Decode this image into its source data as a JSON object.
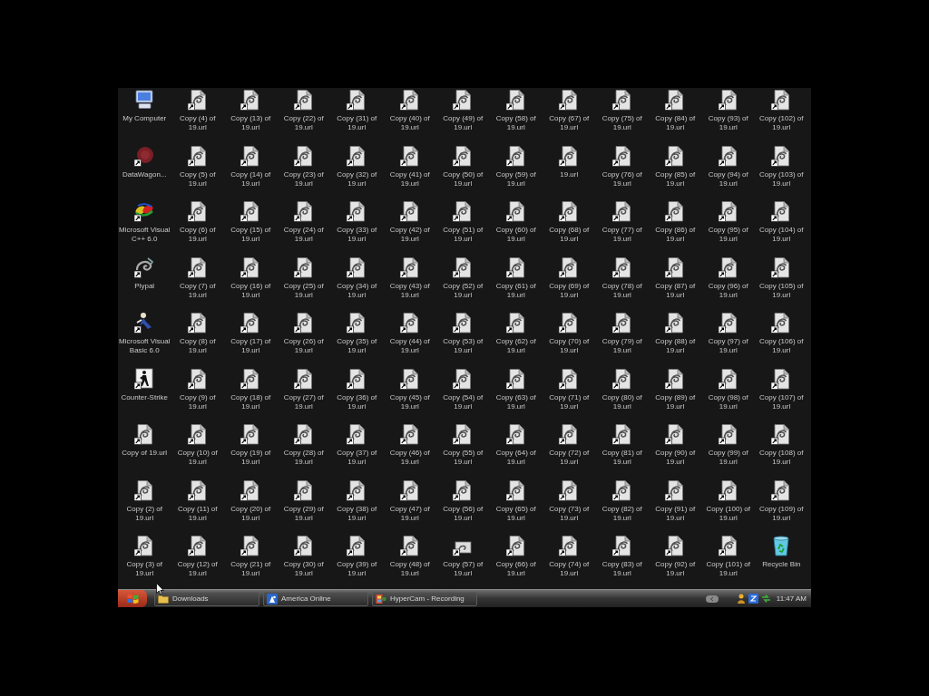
{
  "desktop": {
    "icons": [
      {
        "label": "My Computer",
        "kind": "computer",
        "shortcut": false
      },
      {
        "label": "DataWagon...",
        "kind": "disc",
        "shortcut": true
      },
      {
        "label": "Microsoft Visual C++ 6.0",
        "kind": "swirl",
        "shortcut": true
      },
      {
        "label": "Plypal",
        "kind": "knot",
        "shortcut": true
      },
      {
        "label": "Microsoft Visual Basic 6.0",
        "kind": "figure",
        "shortcut": true
      },
      {
        "label": "Counter-Strike",
        "kind": "soldier",
        "shortcut": true
      },
      {
        "label": "Copy of 19.url",
        "kind": "document",
        "shortcut": true
      },
      {
        "label": "Copy (2) of 19.url",
        "kind": "document",
        "shortcut": true
      },
      {
        "label": "Copy (3) of 19.url",
        "kind": "document",
        "shortcut": true
      },
      {
        "label": "Copy (4) of 19.url",
        "kind": "document",
        "shortcut": true
      },
      {
        "label": "Copy (5) of 19.url",
        "kind": "document",
        "shortcut": true
      },
      {
        "label": "Copy (6) of 19.url",
        "kind": "document",
        "shortcut": true
      },
      {
        "label": "Copy (7) of 19.url",
        "kind": "document",
        "shortcut": true
      },
      {
        "label": "Copy (8) of 19.url",
        "kind": "document",
        "shortcut": true
      },
      {
        "label": "Copy (9) of 19.url",
        "kind": "document",
        "shortcut": true
      },
      {
        "label": "Copy (10) of 19.url",
        "kind": "document",
        "shortcut": true
      },
      {
        "label": "Copy (11) of 19.url",
        "kind": "document",
        "shortcut": true
      },
      {
        "label": "Copy (12) of 19.url",
        "kind": "document",
        "shortcut": true
      },
      {
        "label": "Copy (13) of 19.url",
        "kind": "document",
        "shortcut": true
      },
      {
        "label": "Copy (14) of 19.url",
        "kind": "document",
        "shortcut": true
      },
      {
        "label": "Copy (15) of 19.url",
        "kind": "document",
        "shortcut": true
      },
      {
        "label": "Copy (16) of 19.url",
        "kind": "document",
        "shortcut": true
      },
      {
        "label": "Copy (17) of 19.url",
        "kind": "document",
        "shortcut": true
      },
      {
        "label": "Copy (18) of 19.url",
        "kind": "document",
        "shortcut": true
      },
      {
        "label": "Copy (19) of 19.url",
        "kind": "document",
        "shortcut": true
      },
      {
        "label": "Copy (20) of 19.url",
        "kind": "document",
        "shortcut": true
      },
      {
        "label": "Copy (21) of 19.url",
        "kind": "document",
        "shortcut": true
      },
      {
        "label": "Copy (22) of 19.url",
        "kind": "document",
        "shortcut": true
      },
      {
        "label": "Copy (23) of 19.url",
        "kind": "document",
        "shortcut": true
      },
      {
        "label": "Copy (24) of 19.url",
        "kind": "document",
        "shortcut": true
      },
      {
        "label": "Copy (25) of 19.url",
        "kind": "document",
        "shortcut": true
      },
      {
        "label": "Copy (26) of 19.url",
        "kind": "document",
        "shortcut": true
      },
      {
        "label": "Copy (27) of 19.url",
        "kind": "document",
        "shortcut": true
      },
      {
        "label": "Copy (28) of 19.url",
        "kind": "document",
        "shortcut": true
      },
      {
        "label": "Copy (29) of 19.url",
        "kind": "document",
        "shortcut": true
      },
      {
        "label": "Copy (30) of 19.url",
        "kind": "document",
        "shortcut": true
      },
      {
        "label": "Copy (31) of 19.url",
        "kind": "document",
        "shortcut": true
      },
      {
        "label": "Copy (32) of 19.url",
        "kind": "document",
        "shortcut": true
      },
      {
        "label": "Copy (33) of 19.url",
        "kind": "document",
        "shortcut": true
      },
      {
        "label": "Copy (34) of 19.url",
        "kind": "document",
        "shortcut": true
      },
      {
        "label": "Copy (35) of 19.url",
        "kind": "document",
        "shortcut": true
      },
      {
        "label": "Copy (36) of 19.url",
        "kind": "document",
        "shortcut": true
      },
      {
        "label": "Copy (37) of 19.url",
        "kind": "document",
        "shortcut": true
      },
      {
        "label": "Copy (38) of 19.url",
        "kind": "document",
        "shortcut": true
      },
      {
        "label": "Copy (39) of 19.url",
        "kind": "document",
        "shortcut": true
      },
      {
        "label": "Copy (40) of 19.url",
        "kind": "document",
        "shortcut": true
      },
      {
        "label": "Copy (41) of 19.url",
        "kind": "document",
        "shortcut": true
      },
      {
        "label": "Copy (42) of 19.url",
        "kind": "document",
        "shortcut": true
      },
      {
        "label": "Copy (43) of 19.url",
        "kind": "document",
        "shortcut": true
      },
      {
        "label": "Copy (44) of 19.url",
        "kind": "document",
        "shortcut": true
      },
      {
        "label": "Copy (45) of 19.url",
        "kind": "document",
        "shortcut": true
      },
      {
        "label": "Copy (46) of 19.url",
        "kind": "document",
        "shortcut": true
      },
      {
        "label": "Copy (47) of 19.url",
        "kind": "document",
        "shortcut": true
      },
      {
        "label": "Copy (48) of 19.url",
        "kind": "document",
        "shortcut": true
      },
      {
        "label": "Copy (49) of 19.url",
        "kind": "document",
        "shortcut": true
      },
      {
        "label": "Copy (50) of 19.url",
        "kind": "document",
        "shortcut": true
      },
      {
        "label": "Copy (51) of 19.url",
        "kind": "document",
        "shortcut": true
      },
      {
        "label": "Copy (52) of 19.url",
        "kind": "document",
        "shortcut": true
      },
      {
        "label": "Copy (53) of 19.url",
        "kind": "document",
        "shortcut": true
      },
      {
        "label": "Copy (54) of 19.url",
        "kind": "document",
        "shortcut": true
      },
      {
        "label": "Copy (55) of 19.url",
        "kind": "document",
        "shortcut": true
      },
      {
        "label": "Copy (56) of 19.url",
        "kind": "document",
        "shortcut": true
      },
      {
        "label": "Copy (57) of 19.url",
        "kind": "card",
        "shortcut": true
      },
      {
        "label": "Copy (58) of 19.url",
        "kind": "document",
        "shortcut": true
      },
      {
        "label": "Copy (59) of 19.url",
        "kind": "document",
        "shortcut": true
      },
      {
        "label": "Copy (60) of 19.url",
        "kind": "document",
        "shortcut": true
      },
      {
        "label": "Copy (61) of 19.url",
        "kind": "document",
        "shortcut": true
      },
      {
        "label": "Copy (62) of 19.url",
        "kind": "document",
        "shortcut": true
      },
      {
        "label": "Copy (63) of 19.url",
        "kind": "document",
        "shortcut": true
      },
      {
        "label": "Copy (64) of 19.url",
        "kind": "document",
        "shortcut": true
      },
      {
        "label": "Copy (65) of 19.url",
        "kind": "document",
        "shortcut": true
      },
      {
        "label": "Copy (66) of 19.url",
        "kind": "document",
        "shortcut": true
      },
      {
        "label": "Copy (67) of 19.url",
        "kind": "document",
        "shortcut": true
      },
      {
        "label": "19.url",
        "kind": "document",
        "shortcut": true
      },
      {
        "label": "Copy (68) of 19.url",
        "kind": "document",
        "shortcut": true
      },
      {
        "label": "Copy (69) of 19.url",
        "kind": "document",
        "shortcut": true
      },
      {
        "label": "Copy (70) of 19.url",
        "kind": "document",
        "shortcut": true
      },
      {
        "label": "Copy (71) of 19.url",
        "kind": "document",
        "shortcut": true
      },
      {
        "label": "Copy (72) of 19.url",
        "kind": "document",
        "shortcut": true
      },
      {
        "label": "Copy (73) of 19.url",
        "kind": "document",
        "shortcut": true
      },
      {
        "label": "Copy (74) of 19.url",
        "kind": "document",
        "shortcut": true
      },
      {
        "label": "Copy (75) of 19.url",
        "kind": "document",
        "shortcut": true
      },
      {
        "label": "Copy (76) of 19.url",
        "kind": "document",
        "shortcut": true
      },
      {
        "label": "Copy (77) of 19.url",
        "kind": "document",
        "shortcut": true
      },
      {
        "label": "Copy (78) of 19.url",
        "kind": "document",
        "shortcut": true
      },
      {
        "label": "Copy (79) of 19.url",
        "kind": "document",
        "shortcut": true
      },
      {
        "label": "Copy (80) of 19.url",
        "kind": "document",
        "shortcut": true
      },
      {
        "label": "Copy (81) of 19.url",
        "kind": "document",
        "shortcut": true
      },
      {
        "label": "Copy (82) of 19.url",
        "kind": "document",
        "shortcut": true
      },
      {
        "label": "Copy (83) of 19.url",
        "kind": "document",
        "shortcut": true
      },
      {
        "label": "Copy (84) of 19.url",
        "kind": "document",
        "shortcut": true
      },
      {
        "label": "Copy (85) of 19.url",
        "kind": "document",
        "shortcut": true
      },
      {
        "label": "Copy (86) of 19.url",
        "kind": "document",
        "shortcut": true
      },
      {
        "label": "Copy (87) of 19.url",
        "kind": "document",
        "shortcut": true
      },
      {
        "label": "Copy (88) of 19.url",
        "kind": "document",
        "shortcut": true
      },
      {
        "label": "Copy (89) of 19.url",
        "kind": "document",
        "shortcut": true
      },
      {
        "label": "Copy (90) of 19.url",
        "kind": "document",
        "shortcut": true
      },
      {
        "label": "Copy (91) of 19.url",
        "kind": "document",
        "shortcut": true
      },
      {
        "label": "Copy (92) of 19.url",
        "kind": "document",
        "shortcut": true
      },
      {
        "label": "Copy (93) of 19.url",
        "kind": "document",
        "shortcut": true
      },
      {
        "label": "Copy (94) of 19.url",
        "kind": "document",
        "shortcut": true
      },
      {
        "label": "Copy (95) of 19.url",
        "kind": "document",
        "shortcut": true
      },
      {
        "label": "Copy (96) of 19.url",
        "kind": "document",
        "shortcut": true
      },
      {
        "label": "Copy (97) of 19.url",
        "kind": "document",
        "shortcut": true
      },
      {
        "label": "Copy (98) of 19.url",
        "kind": "document",
        "shortcut": true
      },
      {
        "label": "Copy (99) of 19.url",
        "kind": "document",
        "shortcut": true
      },
      {
        "label": "Copy (100) of 19.url",
        "kind": "document",
        "shortcut": true
      },
      {
        "label": "Copy (101) of 19.url",
        "kind": "document",
        "shortcut": true
      },
      {
        "label": "Copy (102) of 19.url",
        "kind": "document",
        "shortcut": true
      },
      {
        "label": "Copy (103) of 19.url",
        "kind": "document",
        "shortcut": true
      },
      {
        "label": "Copy (104) of 19.url",
        "kind": "document",
        "shortcut": true
      },
      {
        "label": "Copy (105) of 19.url",
        "kind": "document",
        "shortcut": true
      },
      {
        "label": "Copy (106) of 19.url",
        "kind": "document",
        "shortcut": true
      },
      {
        "label": "Copy (107) of 19.url",
        "kind": "document",
        "shortcut": true
      },
      {
        "label": "Copy (108) of 19.url",
        "kind": "document",
        "shortcut": true
      },
      {
        "label": "Copy (109) of 19.url",
        "kind": "document",
        "shortcut": true
      },
      {
        "label": "Recycle Bin",
        "kind": "recyclebin",
        "shortcut": false
      }
    ]
  },
  "taskbar": {
    "buttons": [
      {
        "label": "Downloads",
        "kind": "folder",
        "selected": false
      },
      {
        "label": "America Online",
        "kind": "figure",
        "selected": false
      },
      {
        "label": "HyperCam - Recording",
        "kind": "film",
        "selected": false
      }
    ],
    "tray": {
      "clock": "11:47 AM"
    }
  }
}
